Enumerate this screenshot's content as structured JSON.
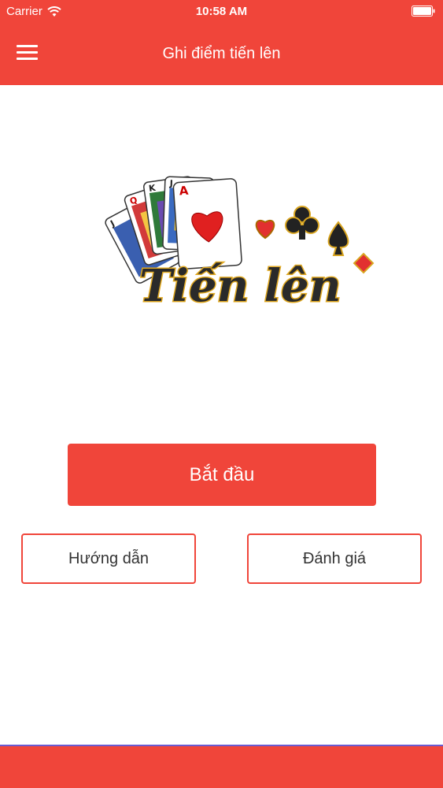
{
  "status_bar": {
    "carrier": "Carrier",
    "time": "10:58 AM"
  },
  "nav": {
    "title": "Ghi điểm tiến lên"
  },
  "logo": {
    "text": "Tiến lên"
  },
  "buttons": {
    "start": "Bắt đầu",
    "guide": "Hướng dẫn",
    "rate": "Đánh giá"
  },
  "colors": {
    "accent": "#f0453a"
  }
}
